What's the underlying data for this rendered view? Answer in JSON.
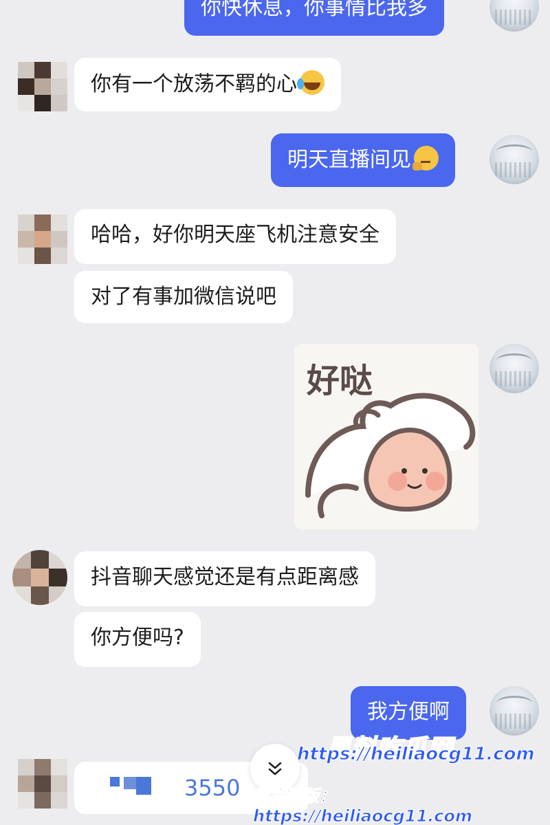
{
  "messages": [
    {
      "side": "right",
      "text": "你快休息，你事情比我多"
    },
    {
      "side": "left",
      "text": "你有一个放荡不羁的心",
      "emoji": "tears-of-joy-icon"
    },
    {
      "side": "right",
      "text": "明天直播间见",
      "emoji": "thinking-face-icon"
    },
    {
      "side": "left",
      "text": "哈哈，好你明天座飞机注意安全"
    },
    {
      "side": "left",
      "text": "对了有事加微信说吧"
    },
    {
      "side": "right",
      "type": "sticker",
      "text": "好哒"
    },
    {
      "side": "left",
      "text": "抖音聊天感觉还是有点距离感"
    },
    {
      "side": "left",
      "text": "你方便吗?"
    },
    {
      "side": "right",
      "text": "我方便啊"
    }
  ],
  "input_preview": {
    "text": "3550"
  },
  "scroll_button": {
    "icon": "double-chevron-down-icon"
  },
  "watermark": {
    "logo": "黑料吃瓜网",
    "url": "https://heiliaocg11.com",
    "prefix": "看完整版：",
    "short_url": "https://heiliaocg11.com"
  },
  "colors": {
    "background": "#ededf0",
    "bubble_left": "#ffffff",
    "bubble_right": "#4a67ee",
    "watermark": "#2d5bf0"
  }
}
